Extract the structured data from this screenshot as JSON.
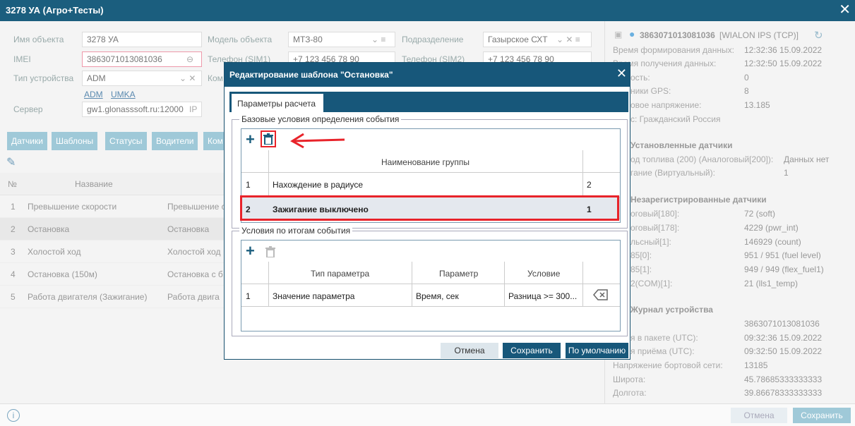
{
  "window": {
    "title": "3278 УА (Агро+Тесты)"
  },
  "form": {
    "name_label": "Имя объекта",
    "name_value": "3278 УА",
    "imei_label": "IMEI",
    "imei_value": "3863071013081036",
    "device_type_label": "Тип устройства",
    "device_type_value": "ADM",
    "device_links": [
      "ADM",
      "UMKA"
    ],
    "server_label": "Сервер",
    "server_value": "gw1.glonasssoft.ru:12000",
    "server_suffix": "IP",
    "model_label": "Модель объекта",
    "model_value": "МТЗ-80",
    "phone1_label": "Телефон (SIM1)",
    "phone1_value": "+7 123 456 78 90",
    "comment_label": "Ком",
    "division_label": "Подразделение",
    "division_value": "Газырское СХТ",
    "phone2_label": "Телефон (SIM2)",
    "phone2_value": "+7 123 456 78 90"
  },
  "tabs": [
    "Датчики",
    "Шаблоны",
    "Статусы",
    "Водители",
    "Ком"
  ],
  "grid": {
    "headers": [
      "№",
      "Название"
    ],
    "rows": [
      {
        "n": "1",
        "name": "Превышение скорости",
        "desc": "Превышение с"
      },
      {
        "n": "2",
        "name": "Остановка",
        "desc": "Остановка"
      },
      {
        "n": "3",
        "name": "Холостой ход",
        "desc": "Холостой ход"
      },
      {
        "n": "4",
        "name": "Остановка (150м)",
        "desc": "Остановка с б"
      },
      {
        "n": "5",
        "name": "Работа двигателя (Зажигание)",
        "desc": "Работа двига"
      }
    ]
  },
  "right_panel": {
    "device_id": "3863071013081036",
    "protocol": "[WIALON IPS (TCP)]",
    "info": [
      {
        "label": "Время формирования данных:",
        "value": "12:32:36 15.09.2022"
      },
      {
        "label": "Время получения данных:",
        "value": "12:32:50 15.09.2022"
      },
      {
        "label": "ость:",
        "value": "0"
      },
      {
        "label": "ники GPS:",
        "value": "8"
      },
      {
        "label": "овое напряжение:",
        "value": "13.185"
      },
      {
        "label": "с: Гражданский Россия",
        "value": ""
      }
    ],
    "installed_header": "Установленные датчики",
    "installed": [
      {
        "label": "од топлива (200) (Аналоговый[200]):",
        "value": "Данных нет"
      },
      {
        "label": "гание (Виртуальный):",
        "value": "1"
      }
    ],
    "unregistered_header": "Незарегистрированные датчики",
    "unregistered": [
      {
        "label": "оговый[180]:",
        "value": "72 (soft)"
      },
      {
        "label": "оговый[178]:",
        "value": "4229 (pwr_int)"
      },
      {
        "label": "льсный[1]:",
        "value": "146929 (count)"
      },
      {
        "label": "85[0]:",
        "value": "951 / 951 (fuel level)"
      },
      {
        "label": "85[1]:",
        "value": "949 / 949 (flex_fuel1)"
      },
      {
        "label": "2(COM)[1]:",
        "value": "21 (lls1_temp)"
      }
    ],
    "journal_header": "Журнал устройства",
    "journal": [
      {
        "label": "",
        "value": "3863071013081036"
      },
      {
        "label": "я в пакете (UTC):",
        "value": "09:32:36 15.09.2022"
      },
      {
        "label": "я приёма (UTC):",
        "value": "09:32:50 15.09.2022"
      },
      {
        "label": "Напряжение бортовой сети:",
        "value": "13185"
      },
      {
        "label": "Широта:",
        "value": "45.78685333333333"
      },
      {
        "label": "Долгота:",
        "value": "39.86678333333333"
      }
    ]
  },
  "footer": {
    "cancel": "Отмена",
    "save": "Сохранить"
  },
  "modal": {
    "title": "Редактирование шаблона \"Остановка\"",
    "tab": "Параметры расчета",
    "base_legend": "Базовые условия определения события",
    "base_header": "Наименование группы",
    "base_rows": [
      {
        "n": "1",
        "name": "Нахождение в радиусе",
        "count": "2"
      },
      {
        "n": "2",
        "name": "Зажигание выключено",
        "count": "1"
      }
    ],
    "result_legend": "Условия по итогам события",
    "result_headers": [
      "Тип параметра",
      "Параметр",
      "Условие"
    ],
    "result_rows": [
      {
        "n": "1",
        "type": "Значение параметра",
        "param": "Время, сек",
        "cond": "Разница >= 300..."
      }
    ],
    "buttons": {
      "cancel": "Отмена",
      "save": "Сохранить",
      "default": "По умолчанию"
    }
  },
  "colors": {
    "header": "#17577a",
    "highlight": "#e8232a"
  }
}
